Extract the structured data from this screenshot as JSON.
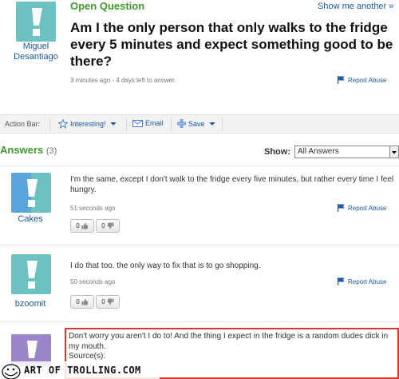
{
  "question": {
    "status_label": "Open Question",
    "show_me_another": "Show me another »",
    "asker": "Miguel Desantiago",
    "title": "Am I the only person that only walks to the fridge every 5 minutes and expect something good to be there?",
    "meta": "3 minutes ago - 4 days left to answer.",
    "report_abuse": "Report Abuse"
  },
  "action_bar": {
    "label": "Action Bar:",
    "interesting": "Interesting!",
    "email": "Email",
    "save": "Save"
  },
  "answers_header": {
    "title": "Answers",
    "count": "(3)",
    "show_label": "Show:",
    "show_value": "All Answers"
  },
  "answers": [
    {
      "user": "Cakes",
      "text": "I'm the same, except I don't walk to the fridge every five minutes, but rather every time I feel hungry.",
      "time": "51 seconds ago",
      "report_abuse": "Report Abuse",
      "thumbs_up": "0",
      "thumbs_down": "0"
    },
    {
      "user": "bzoomit",
      "text": "I do that too. the only way to fix that is to go shopping.",
      "time": "50 seconds ago",
      "report_abuse": "Report Abuse",
      "thumbs_up": "0",
      "thumbs_down": "0"
    },
    {
      "user": "",
      "text": "Don't worry you aren't I do to! And the thing I expect in the fridge is a random dudes dick in my mouth.",
      "sources": "Source(s):"
    }
  ],
  "watermark": "ART OF TROLLING.COM",
  "colors": {
    "link": "#1a5aa6",
    "status_green": "#3d9a2b",
    "avatar_teal": "#6cc2c0",
    "avatar_purple": "#9a86c9",
    "highlight_red": "#d63a2e"
  },
  "icons": [
    "yahoo-answers-avatar-icon",
    "report-flag-icon",
    "star-icon",
    "email-icon",
    "save-plus-icon",
    "dropdown-arrow-icon",
    "thumbs-up-icon",
    "thumbs-down-icon"
  ]
}
